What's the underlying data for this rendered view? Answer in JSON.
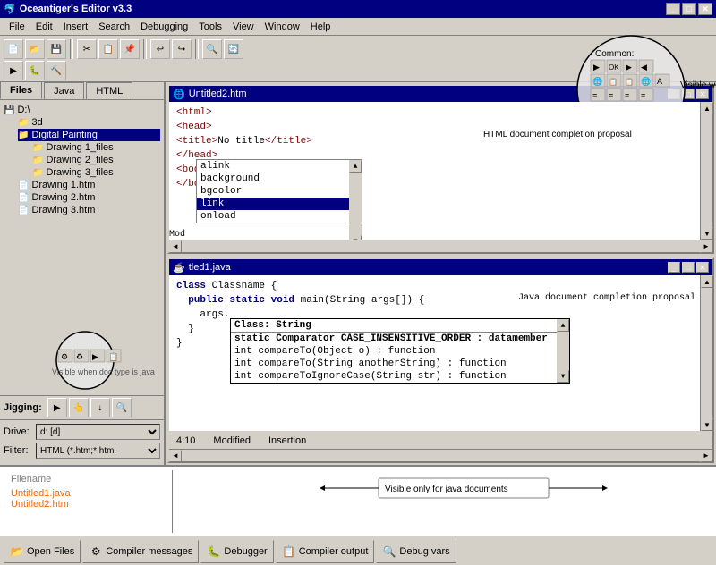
{
  "app": {
    "title": "Oceantiger's Editor v3.3",
    "title_icon": "🐬"
  },
  "title_buttons": [
    "_",
    "□",
    "✕"
  ],
  "menu": {
    "items": [
      "File",
      "Edit",
      "Insert",
      "Search",
      "Debugging",
      "Tools",
      "View",
      "Window",
      "Help"
    ]
  },
  "tabs": {
    "items": [
      "Files",
      "Java",
      "HTML"
    ],
    "active": "Files"
  },
  "file_tree": {
    "items": [
      {
        "label": "D:\\",
        "icon": "💾",
        "indent": 0
      },
      {
        "label": "3d",
        "icon": "📁",
        "indent": 1
      },
      {
        "label": "Digital Painting",
        "icon": "📁",
        "indent": 1,
        "selected": true
      },
      {
        "label": "Drawing 1_files",
        "icon": "📁",
        "indent": 2
      },
      {
        "label": "Drawing 2_files",
        "icon": "📁",
        "indent": 2
      },
      {
        "label": "Drawing 3_files",
        "icon": "📁",
        "indent": 2
      },
      {
        "label": "Drawing 1.htm",
        "icon": "📄",
        "indent": 1
      },
      {
        "label": "Drawing 2.htm",
        "icon": "📄",
        "indent": 1
      },
      {
        "label": "Drawing 3.htm",
        "icon": "📄",
        "indent": 1
      }
    ]
  },
  "drive": {
    "label": "Drive:",
    "value": "d: [d]"
  },
  "filter": {
    "label": "Filter:",
    "value": "HTML (*.htm;*.html"
  },
  "editor_html": {
    "title": "Untitled2.htm",
    "icon": "🌐",
    "content": "<html>\n<head>\n<title>No title</title>\n</head>\n<body >\n</body>",
    "completion": {
      "items": [
        "alink",
        "background",
        "bgcolor",
        "link",
        "onload"
      ],
      "selected": "link"
    }
  },
  "editor_java": {
    "title": "tled1.java",
    "full_title": "Untitled1.java",
    "content": "class Classname {\n  public static void main(String args[]) {\n    args.\n  }\n}",
    "status": {
      "position": "4:10",
      "state": "Modified",
      "mode": "Insertion"
    },
    "completion": {
      "title": "Class: String",
      "items": [
        {
          "text": "static Comparator CASE_INSENSITIVE_ORDER : datamember",
          "bold": true
        },
        {
          "text": "int compareTo(Object o) : function",
          "bold": false
        },
        {
          "text": "int compareTo(String anotherString) : function",
          "bold": false
        },
        {
          "text": "int compareToIgnoreCase(String str) : function",
          "bold": false
        }
      ]
    }
  },
  "annotations": {
    "html_toolbar": "Visible when current document type is html.",
    "java_toolbar": "Visible when doc type is java",
    "html_completion": "HTML document completion proposal",
    "java_completion": "Java document completion proposal",
    "bottom_visible": "Visible only for java documents"
  },
  "debugbar": {
    "label": "Jigging:"
  },
  "bottom_files": {
    "header": "Filename",
    "items": [
      "Untitled1.java",
      "Untitled2.htm"
    ]
  },
  "bottom_buttons": [
    {
      "id": "open-files",
      "icon": "📂",
      "label": "Open Files"
    },
    {
      "id": "compiler-messages",
      "icon": "⚙",
      "label": "Compiler messages"
    },
    {
      "id": "debugger",
      "icon": "🐛",
      "label": "Debugger"
    },
    {
      "id": "compiler-output",
      "icon": "📋",
      "label": "Compiler output"
    },
    {
      "id": "debug-vars",
      "icon": "🔍",
      "label": "Debug vars"
    }
  ],
  "toolbar": {
    "common_label": "Common:",
    "html_visible_note": "Visible when current document type is html.",
    "buttons_row1": [
      "▶",
      "OK",
      "▶"
    ],
    "buttons_row2": [
      "🌐",
      "📋",
      "📋",
      "🌐",
      "A"
    ],
    "buttons_row3": [
      "≡",
      "≡",
      "≡",
      "≡"
    ]
  }
}
